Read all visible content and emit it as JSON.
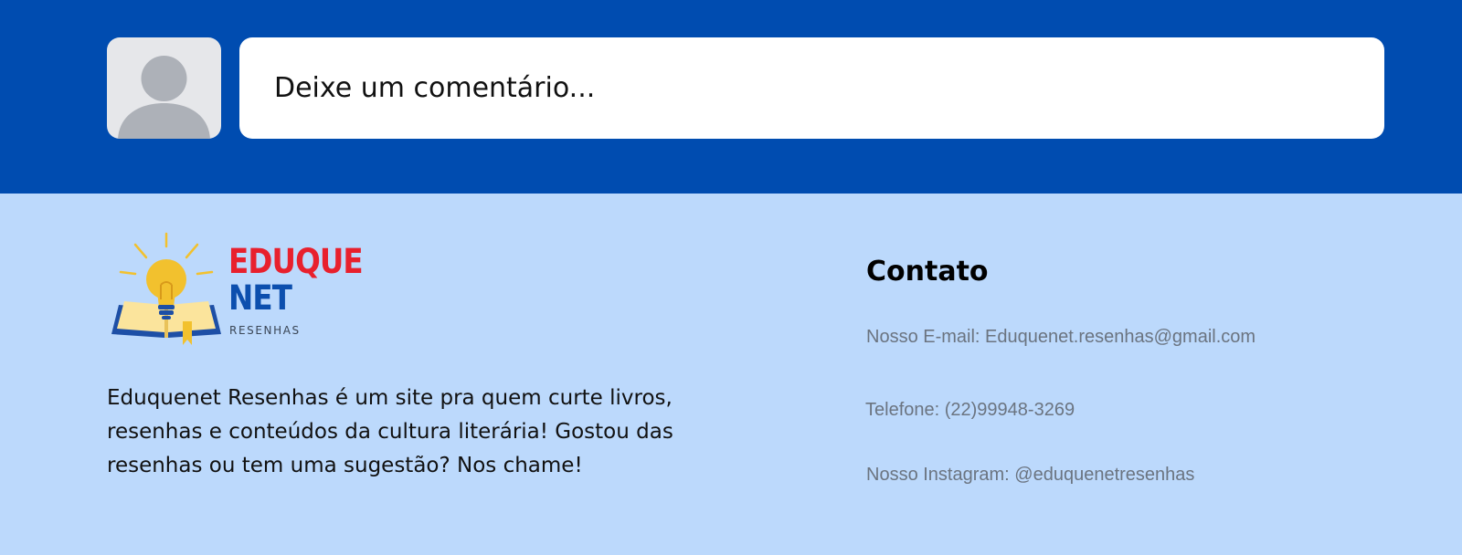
{
  "comment": {
    "placeholder": "Deixe um comentário..."
  },
  "logo": {
    "word1": "EDUQUE",
    "word2": "NET",
    "subtitle": "RESENHAS",
    "icon": "lightbulb-book-icon"
  },
  "about": {
    "text": "Eduquenet Resenhas é um site pra quem curte livros, resenhas e conteúdos da cultura literária! Gostou das resenhas ou tem uma sugestão? Nos chame!"
  },
  "contact": {
    "title": "Contato",
    "email": "Nosso E-mail: Eduquenet.resenhas@gmail.com",
    "phone": "Telefone: (22)99948-3269",
    "instagram": "Nosso Instagram: @eduquenetresenhas"
  },
  "colors": {
    "band": "#004cb0",
    "footer": "#bcd9fc",
    "logo_red": "#e8202d",
    "logo_blue": "#0c4fae"
  }
}
